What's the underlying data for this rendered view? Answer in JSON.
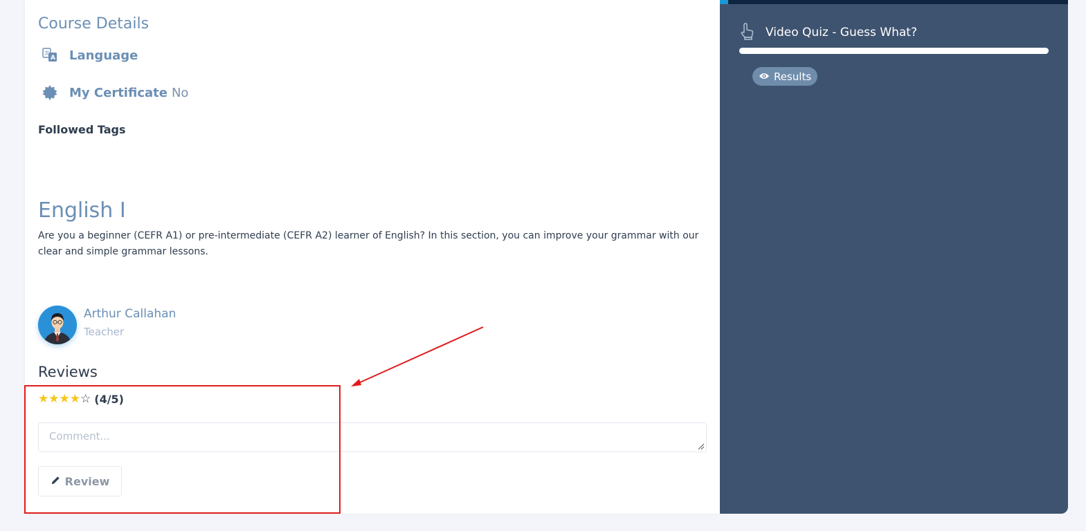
{
  "course_details": {
    "title": "Course Details",
    "language_label": "Language",
    "language_value": "",
    "certificate_label": "My Certificate",
    "certificate_value": "No",
    "followed_tags_label": "Followed Tags"
  },
  "course": {
    "title": "English I",
    "description": "Are you a beginner (CEFR A1) or pre-intermediate (CEFR A2) learner of English? In this section, you can improve your grammar with our clear and simple grammar lessons."
  },
  "teacher": {
    "name": "Arthur Callahan",
    "role": "Teacher"
  },
  "reviews": {
    "title": "Reviews",
    "rating": 4,
    "rating_max": 5,
    "rating_text": "(4/5)",
    "comment_placeholder": "Comment...",
    "comment_value": "",
    "review_button_label": "Review"
  },
  "sidebar": {
    "quiz_title": "Video Quiz - Guess What?",
    "quiz_progress": 1.0,
    "results_label": "Results"
  },
  "colors": {
    "accent_blue": "#6b8fb5",
    "sidebar_bg": "#3e536f",
    "sidebar_topbar": "#0f2440",
    "star": "#f5c518",
    "highlight_red": "#e11b1b"
  },
  "icons": {
    "language": "translate-icon",
    "certificate": "certificate-seal-icon",
    "review_button": "pencil-icon",
    "quiz": "hand-pointer-icon",
    "results": "eye-icon"
  }
}
